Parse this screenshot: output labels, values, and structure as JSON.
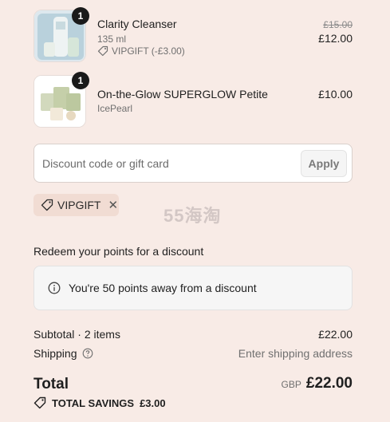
{
  "items": [
    {
      "qty": "1",
      "name": "Clarity Cleanser",
      "variant": "135 ml",
      "discount": "VIPGIFT (-£3.00)",
      "original_price": "£15.00",
      "price": "£12.00"
    },
    {
      "qty": "1",
      "name": "On-the-Glow SUPERGLOW Petite",
      "variant": "IcePearl",
      "price": "£10.00"
    }
  ],
  "discount": {
    "placeholder": "Discount code or gift card",
    "apply_label": "Apply",
    "applied_code": "VIPGIFT"
  },
  "watermark": "55海淘",
  "points": {
    "heading": "Redeem your points for a discount",
    "message": "You're 50 points away from a discount"
  },
  "summary": {
    "subtotal_label": "Subtotal · 2 items",
    "subtotal_value": "£22.00",
    "shipping_label": "Shipping",
    "shipping_value": "Enter shipping address",
    "total_label": "Total",
    "currency": "GBP",
    "total_value": "£22.00",
    "savings_label": "TOTAL SAVINGS",
    "savings_value": "£3.00"
  },
  "colors": {
    "background": "#f8ebe6",
    "chip": "#f1dcd3",
    "badge": "#1a1a1a"
  }
}
